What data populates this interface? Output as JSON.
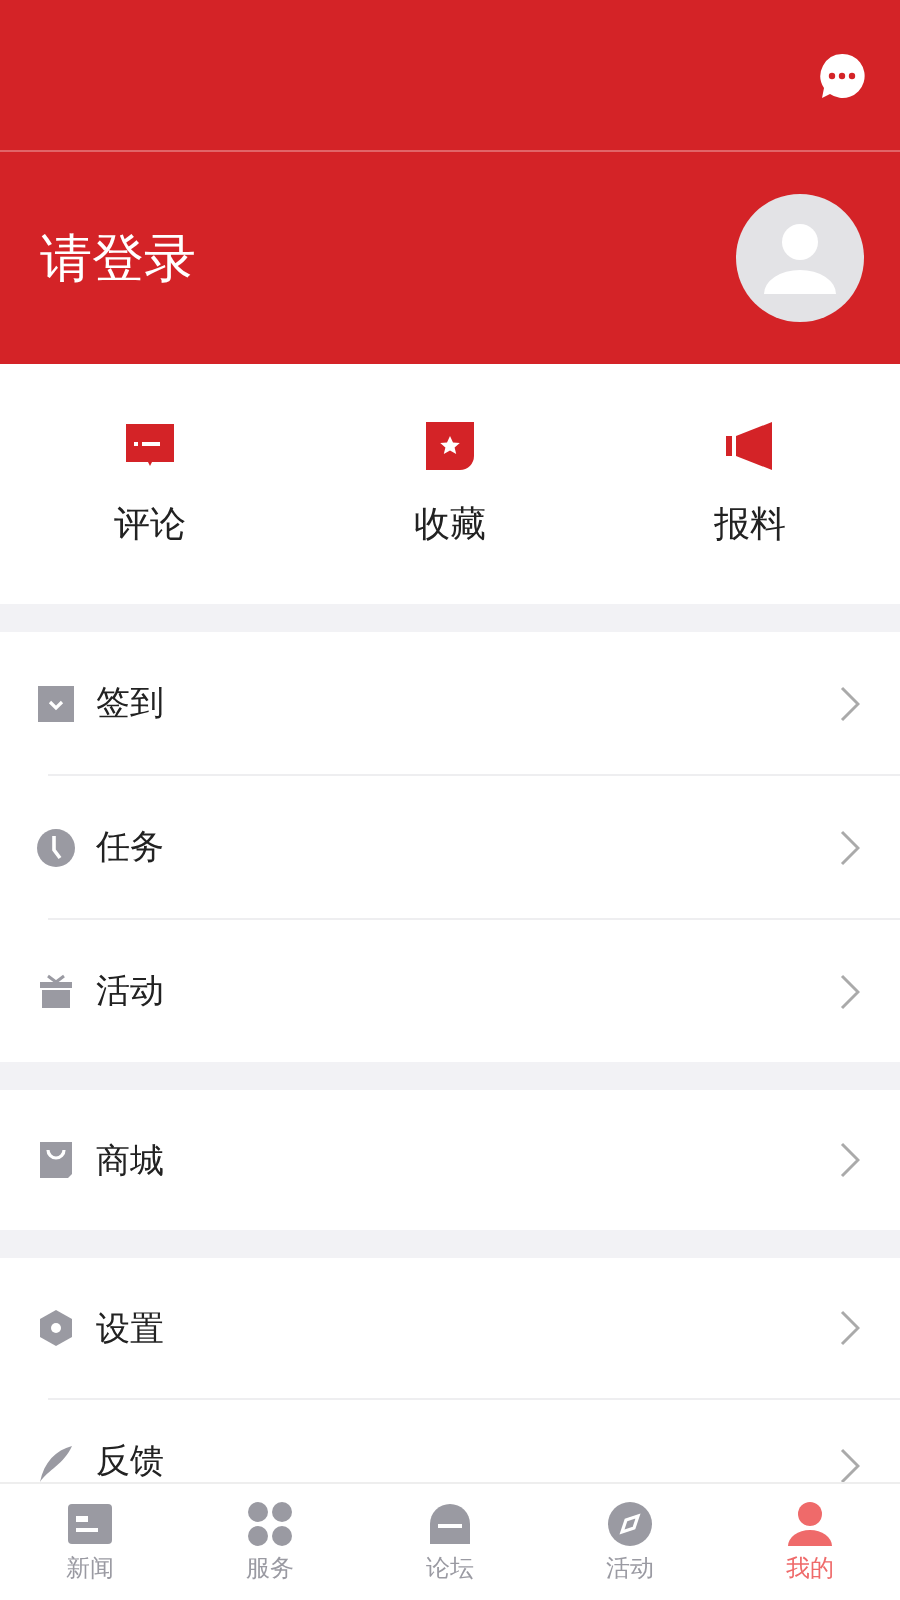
{
  "header": {
    "login_text": "请登录"
  },
  "quick_actions": [
    {
      "kind": "comment",
      "label": "评论"
    },
    {
      "kind": "favorite",
      "label": "收藏"
    },
    {
      "kind": "report",
      "label": "报料"
    }
  ],
  "menu_groups": [
    [
      {
        "kind": "checkin",
        "label": "签到"
      },
      {
        "kind": "task",
        "label": "任务"
      },
      {
        "kind": "gift",
        "label": "活动"
      }
    ],
    [
      {
        "kind": "shop",
        "label": "商城"
      }
    ],
    [
      {
        "kind": "settings",
        "label": "设置"
      },
      {
        "kind": "feedback",
        "label": "反馈"
      }
    ]
  ],
  "tab_bar": [
    {
      "kind": "news",
      "label": "新闻",
      "selected": false
    },
    {
      "kind": "services",
      "label": "服务",
      "selected": false
    },
    {
      "kind": "forum",
      "label": "论坛",
      "selected": false
    },
    {
      "kind": "explore",
      "label": "活动",
      "selected": false
    },
    {
      "kind": "profile",
      "label": "我的",
      "selected": true
    }
  ]
}
